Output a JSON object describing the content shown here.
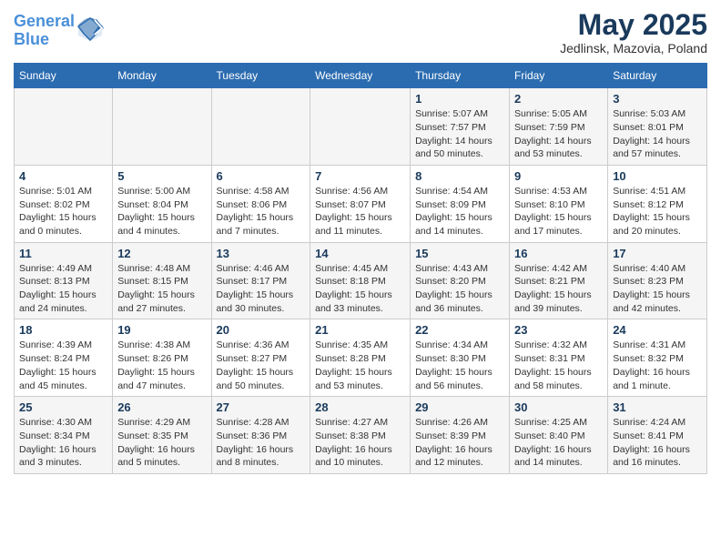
{
  "logo": {
    "line1": "General",
    "line2": "Blue"
  },
  "title": "May 2025",
  "location": "Jedlinsk, Mazovia, Poland",
  "weekdays": [
    "Sunday",
    "Monday",
    "Tuesday",
    "Wednesday",
    "Thursday",
    "Friday",
    "Saturday"
  ],
  "weeks": [
    [
      {
        "day": "",
        "info": ""
      },
      {
        "day": "",
        "info": ""
      },
      {
        "day": "",
        "info": ""
      },
      {
        "day": "",
        "info": ""
      },
      {
        "day": "1",
        "info": "Sunrise: 5:07 AM\nSunset: 7:57 PM\nDaylight: 14 hours\nand 50 minutes."
      },
      {
        "day": "2",
        "info": "Sunrise: 5:05 AM\nSunset: 7:59 PM\nDaylight: 14 hours\nand 53 minutes."
      },
      {
        "day": "3",
        "info": "Sunrise: 5:03 AM\nSunset: 8:01 PM\nDaylight: 14 hours\nand 57 minutes."
      }
    ],
    [
      {
        "day": "4",
        "info": "Sunrise: 5:01 AM\nSunset: 8:02 PM\nDaylight: 15 hours\nand 0 minutes."
      },
      {
        "day": "5",
        "info": "Sunrise: 5:00 AM\nSunset: 8:04 PM\nDaylight: 15 hours\nand 4 minutes."
      },
      {
        "day": "6",
        "info": "Sunrise: 4:58 AM\nSunset: 8:06 PM\nDaylight: 15 hours\nand 7 minutes."
      },
      {
        "day": "7",
        "info": "Sunrise: 4:56 AM\nSunset: 8:07 PM\nDaylight: 15 hours\nand 11 minutes."
      },
      {
        "day": "8",
        "info": "Sunrise: 4:54 AM\nSunset: 8:09 PM\nDaylight: 15 hours\nand 14 minutes."
      },
      {
        "day": "9",
        "info": "Sunrise: 4:53 AM\nSunset: 8:10 PM\nDaylight: 15 hours\nand 17 minutes."
      },
      {
        "day": "10",
        "info": "Sunrise: 4:51 AM\nSunset: 8:12 PM\nDaylight: 15 hours\nand 20 minutes."
      }
    ],
    [
      {
        "day": "11",
        "info": "Sunrise: 4:49 AM\nSunset: 8:13 PM\nDaylight: 15 hours\nand 24 minutes."
      },
      {
        "day": "12",
        "info": "Sunrise: 4:48 AM\nSunset: 8:15 PM\nDaylight: 15 hours\nand 27 minutes."
      },
      {
        "day": "13",
        "info": "Sunrise: 4:46 AM\nSunset: 8:17 PM\nDaylight: 15 hours\nand 30 minutes."
      },
      {
        "day": "14",
        "info": "Sunrise: 4:45 AM\nSunset: 8:18 PM\nDaylight: 15 hours\nand 33 minutes."
      },
      {
        "day": "15",
        "info": "Sunrise: 4:43 AM\nSunset: 8:20 PM\nDaylight: 15 hours\nand 36 minutes."
      },
      {
        "day": "16",
        "info": "Sunrise: 4:42 AM\nSunset: 8:21 PM\nDaylight: 15 hours\nand 39 minutes."
      },
      {
        "day": "17",
        "info": "Sunrise: 4:40 AM\nSunset: 8:23 PM\nDaylight: 15 hours\nand 42 minutes."
      }
    ],
    [
      {
        "day": "18",
        "info": "Sunrise: 4:39 AM\nSunset: 8:24 PM\nDaylight: 15 hours\nand 45 minutes."
      },
      {
        "day": "19",
        "info": "Sunrise: 4:38 AM\nSunset: 8:26 PM\nDaylight: 15 hours\nand 47 minutes."
      },
      {
        "day": "20",
        "info": "Sunrise: 4:36 AM\nSunset: 8:27 PM\nDaylight: 15 hours\nand 50 minutes."
      },
      {
        "day": "21",
        "info": "Sunrise: 4:35 AM\nSunset: 8:28 PM\nDaylight: 15 hours\nand 53 minutes."
      },
      {
        "day": "22",
        "info": "Sunrise: 4:34 AM\nSunset: 8:30 PM\nDaylight: 15 hours\nand 56 minutes."
      },
      {
        "day": "23",
        "info": "Sunrise: 4:32 AM\nSunset: 8:31 PM\nDaylight: 15 hours\nand 58 minutes."
      },
      {
        "day": "24",
        "info": "Sunrise: 4:31 AM\nSunset: 8:32 PM\nDaylight: 16 hours\nand 1 minute."
      }
    ],
    [
      {
        "day": "25",
        "info": "Sunrise: 4:30 AM\nSunset: 8:34 PM\nDaylight: 16 hours\nand 3 minutes."
      },
      {
        "day": "26",
        "info": "Sunrise: 4:29 AM\nSunset: 8:35 PM\nDaylight: 16 hours\nand 5 minutes."
      },
      {
        "day": "27",
        "info": "Sunrise: 4:28 AM\nSunset: 8:36 PM\nDaylight: 16 hours\nand 8 minutes."
      },
      {
        "day": "28",
        "info": "Sunrise: 4:27 AM\nSunset: 8:38 PM\nDaylight: 16 hours\nand 10 minutes."
      },
      {
        "day": "29",
        "info": "Sunrise: 4:26 AM\nSunset: 8:39 PM\nDaylight: 16 hours\nand 12 minutes."
      },
      {
        "day": "30",
        "info": "Sunrise: 4:25 AM\nSunset: 8:40 PM\nDaylight: 16 hours\nand 14 minutes."
      },
      {
        "day": "31",
        "info": "Sunrise: 4:24 AM\nSunset: 8:41 PM\nDaylight: 16 hours\nand 16 minutes."
      }
    ]
  ]
}
